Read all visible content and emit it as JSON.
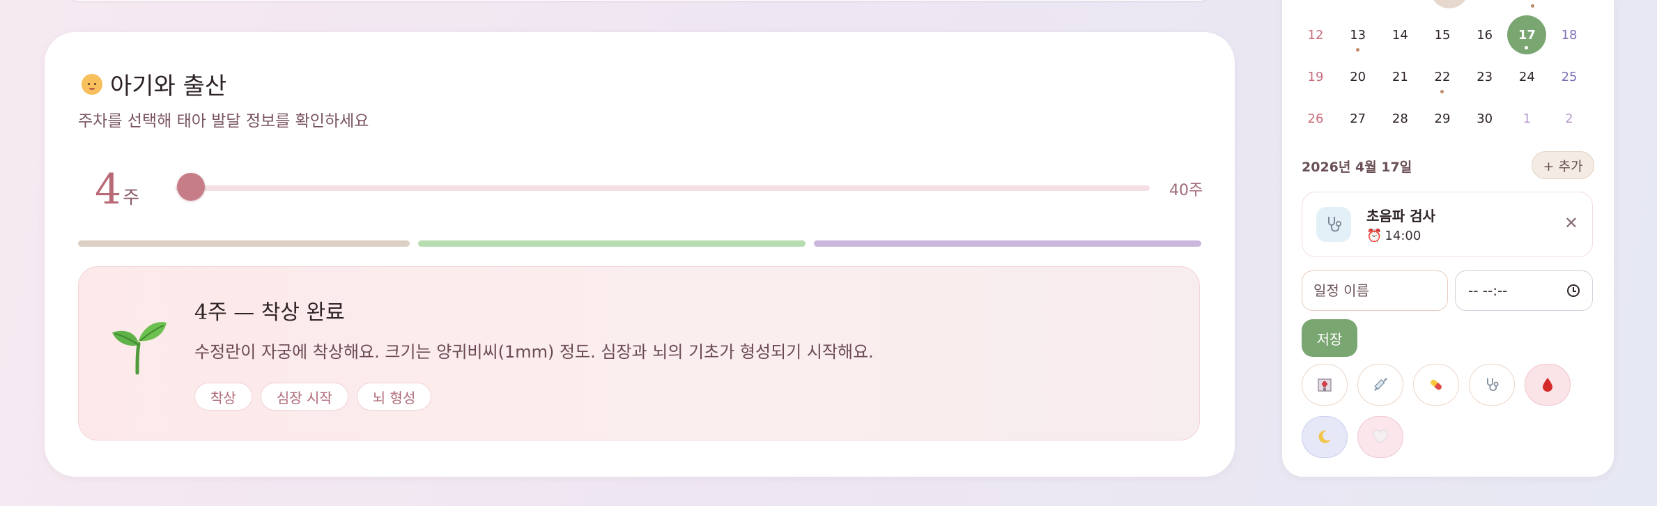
{
  "baby": {
    "title": "아기와 출산",
    "title_icon": "baby-icon",
    "subtitle": "주차를 선택해 태아 발달 정보를 확인하세요",
    "current_week": "4",
    "week_unit": "주",
    "max_week_label": "40주",
    "slider": {
      "min": 4,
      "max": 40,
      "value": 4
    },
    "trimester_colors": [
      "#dcd0c4",
      "#b6dcb0",
      "#cbb7de"
    ],
    "development": {
      "icon": "seedling-icon",
      "title": "4주 — 착상 완료",
      "description": "수정란이 자궁에 착상해요. 크기는 양귀비씨(1mm) 정도. 심장과 뇌의 기초가 형성되기 시작해요.",
      "tags": [
        "착상",
        "심장 시작",
        "뇌 형성"
      ]
    }
  },
  "calendar": {
    "weeks": [
      [
        {
          "d": "12",
          "t": "sun"
        },
        {
          "d": "13",
          "dot": true
        },
        {
          "d": "14"
        },
        {
          "d": "15"
        },
        {
          "d": "16"
        },
        {
          "d": "17",
          "today": true,
          "dot": true
        },
        {
          "d": "18",
          "t": "sat"
        }
      ],
      [
        {
          "d": "19",
          "t": "sun"
        },
        {
          "d": "20"
        },
        {
          "d": "21"
        },
        {
          "d": "22",
          "dot": true
        },
        {
          "d": "23"
        },
        {
          "d": "24"
        },
        {
          "d": "25",
          "t": "sat"
        }
      ],
      [
        {
          "d": "26",
          "t": "sun"
        },
        {
          "d": "27"
        },
        {
          "d": "28"
        },
        {
          "d": "29"
        },
        {
          "d": "30"
        },
        {
          "d": "1",
          "t": "other"
        },
        {
          "d": "2",
          "t": "other"
        }
      ]
    ],
    "selected_date": "2026년 4월 17일",
    "add_label": "+ 추가",
    "event": {
      "icon": "stethoscope-icon",
      "name": "초음파 검사",
      "time": "14:00",
      "time_icon": "alarm-clock-icon",
      "close_icon": "close-icon"
    },
    "form": {
      "name_placeholder": "일정 이름",
      "time_placeholder": "-- --:--",
      "save_label": "저장"
    },
    "quick_icons": [
      "hospital-icon",
      "syringe-icon",
      "pill-icon",
      "stethoscope-icon",
      "blood-drop-icon",
      "moon-icon",
      "heart-icon"
    ],
    "colors": {
      "today": "#7aa672",
      "sunday": "#c96d7c",
      "saturday": "#7a72b8",
      "accent": "#c77d87"
    }
  }
}
